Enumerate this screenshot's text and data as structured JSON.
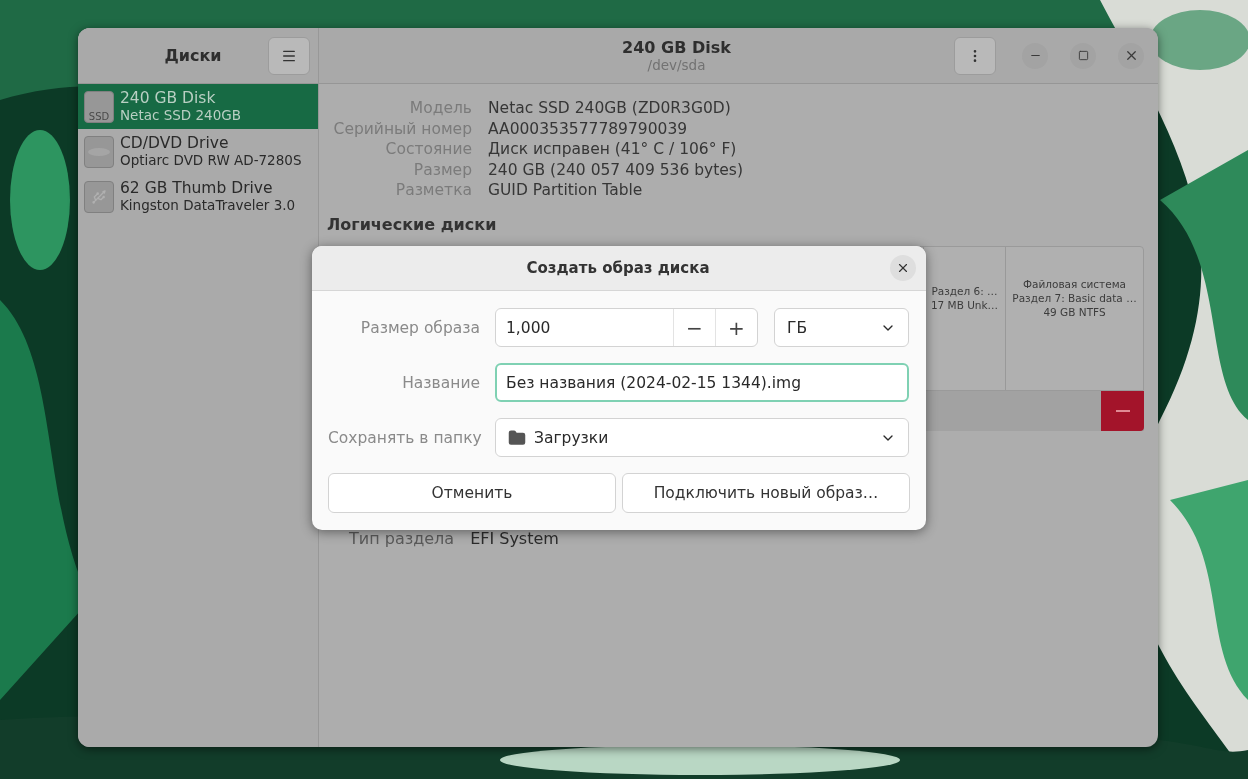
{
  "sidebar": {
    "title": "Диски",
    "items": [
      {
        "name": "240 GB Disk",
        "model": "Netac SSD 240GB",
        "kind": "ssd",
        "icon_text": "SSD",
        "selected": true
      },
      {
        "name": "CD/DVD Drive",
        "model": "Optiarc DVD RW AD-7280S",
        "kind": "optical",
        "selected": false
      },
      {
        "name": "62 GB Thumb Drive",
        "model": "Kingston DataTraveler 3.0",
        "kind": "usb",
        "selected": false
      }
    ]
  },
  "header": {
    "title": "240 GB Disk",
    "subtitle": "/dev/sda"
  },
  "details": [
    {
      "label": "Модель",
      "value": "Netac SSD 240GB (ZD0R3G0D)"
    },
    {
      "label": "Серийный номер",
      "value": "AA000353577789790039"
    },
    {
      "label": "Состояние",
      "value": "Диск исправен (41° C / 106° F)"
    },
    {
      "label": "Размер",
      "value": "240 GB (240 057 409 536 bytes)"
    },
    {
      "label": "Разметка",
      "value": "GUID Partition Table"
    }
  ],
  "volumes": {
    "title": "Логические диски",
    "partitions": [
      {
        "lines": [
          "Раздел 6: …",
          "17 MB Unk…"
        ]
      },
      {
        "lines": [
          "Файловая система",
          "Раздел 7: Basic data …",
          "49 GB NTFS"
        ]
      }
    ],
    "partition_type": {
      "label": "Тип раздела",
      "value": "EFI System"
    }
  },
  "dialog": {
    "title": "Создать образ диска",
    "size": {
      "label": "Размер образа",
      "value": "1,000",
      "minus": "−",
      "plus": "+",
      "unit": "ГБ"
    },
    "name": {
      "label": "Название",
      "value": "Без названия (2024-02-15 1344).img"
    },
    "folder": {
      "label": "Сохранять в папку",
      "value": "Загрузки"
    },
    "buttons": [
      "Отменить",
      "Подключить новый образ…"
    ]
  }
}
